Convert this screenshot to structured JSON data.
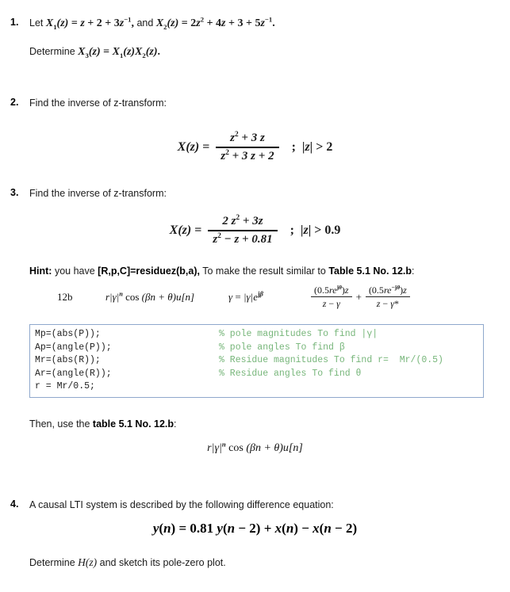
{
  "document": {
    "type": "homework-problem-set",
    "topic": "z-transform problems"
  },
  "problems": [
    {
      "number": "1.",
      "line1_prefix": "Let ",
      "line1_math": "X₁(z) = z + 2 + 3z⁻¹, and X₂(z) = 2z² + 4z + 3 + 5z⁻¹.",
      "line2_prefix": "Determine ",
      "line2_math": "X₃(z) = X₁(z)X₂(z)."
    },
    {
      "number": "2.",
      "prompt": "Find the inverse of z-transform:",
      "equation": {
        "lhs": "X(z) =",
        "numerator": "z² + 3 z",
        "denominator": "z² + 3 z + 2",
        "roc": "; |z| > 2"
      }
    },
    {
      "number": "3.",
      "prompt": "Find the inverse of z-transform:",
      "equation": {
        "lhs": "X(z) =",
        "numerator": "2 z² + 3z",
        "denominator": "z² − z + 0.81",
        "roc": "; |z| > 0.9"
      }
    },
    {
      "number": "4.",
      "prompt": "A causal LTI system is described by the following difference equation:",
      "equation_text": "y(n) = 0.81 y(n − 2) + x(n) − x(n − 2)",
      "follow_up_prefix": "Determine ",
      "follow_up_math": "H(z)",
      "follow_up_suffix": " and sketch its pole-zero plot."
    }
  ],
  "hint": {
    "label": "Hint:",
    "text_1": " you have ",
    "bold_1": "[R,p,C]=residuez(b,a),",
    "text_2": " To make the result similar to ",
    "bold_2": "Table 5.1 No. 12.b",
    "text_3": ":"
  },
  "table_row": {
    "id": "12b",
    "expression": "r|γ|ⁿ cos (βn + θ)u[n]",
    "gamma_def": "γ = |γ|eʲᵝ",
    "fraction_1": {
      "numerator": "(0.5reʲᵩ)z",
      "denominator": "z − γ"
    },
    "operator": "+",
    "fraction_2": {
      "numerator": "(0.5re⁻ʲᵩ)z",
      "denominator": "z − γ*"
    }
  },
  "code_block": {
    "language": "matlab",
    "comment_color": "#77b67a",
    "code_color": "#222222",
    "border_color": "#8fa8cc",
    "lines": [
      {
        "statement": "Mp=(abs(P));",
        "comment": "% pole magnitudes To find |γ|"
      },
      {
        "statement": "Ap=(angle(P));",
        "comment": "% pole angles To find β"
      },
      {
        "statement": "Mr=(abs(R));",
        "comment": "% Residue magnitudes To find r=  Mr/(0.5)"
      },
      {
        "statement": "Ar=(angle(R));",
        "comment": "% Residue angles To find θ"
      },
      {
        "statement": "r = Mr/0.5;",
        "comment": ""
      }
    ]
  },
  "then_use": {
    "text_1": "Then, use the ",
    "bold_1": "table 5.1 No. 12.b",
    "text_2": ":",
    "formula": "r|γ|ⁿ cos (βn + θ)u[n]"
  }
}
